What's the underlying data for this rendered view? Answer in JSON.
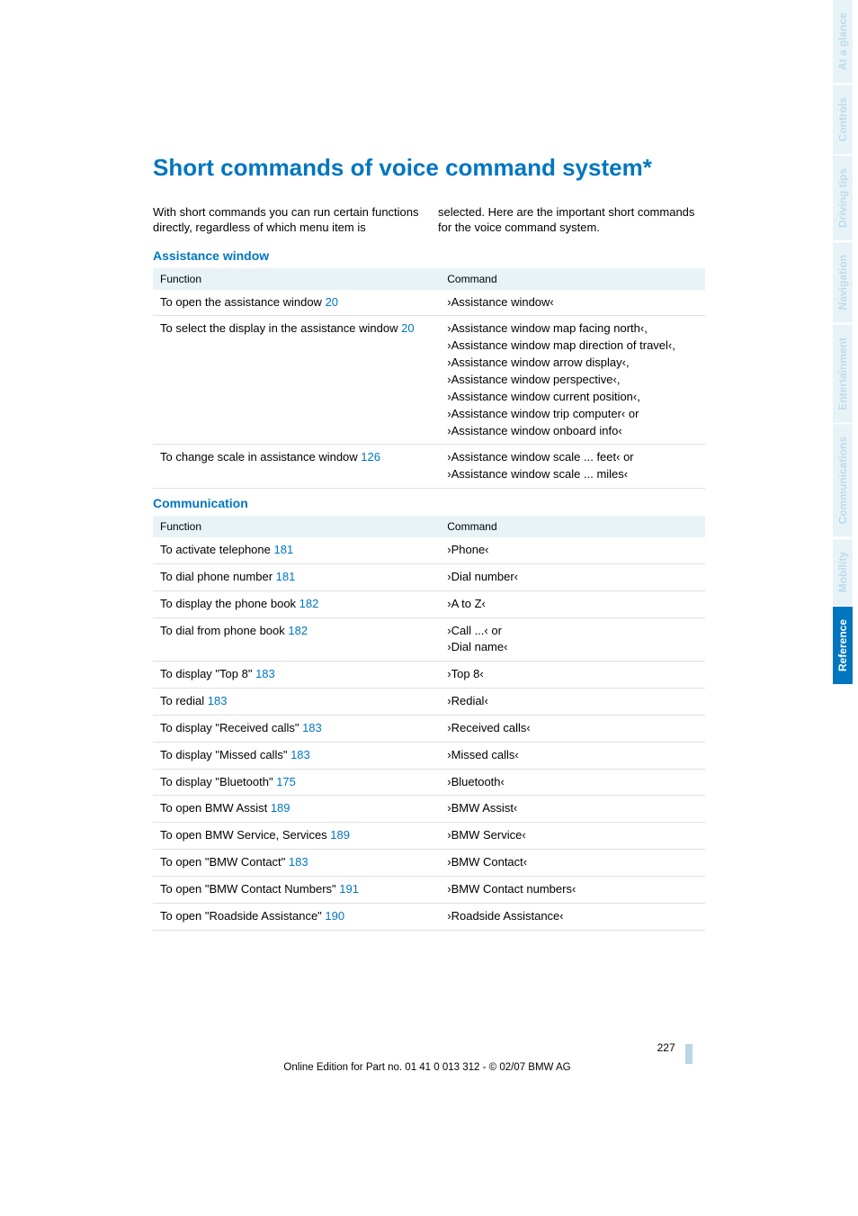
{
  "sideTabs": [
    "At a glance",
    "Controls",
    "Driving tips",
    "Navigation",
    "Entertainment",
    "Communications",
    "Mobility",
    "Reference"
  ],
  "activeTab": "Reference",
  "title": "Short commands of voice command system*",
  "introLeft": "With short commands you can run certain functions directly, regardless of which menu item is",
  "introRight": "selected. Here are the important short commands for the voice command system.",
  "sections": [
    {
      "heading": "Assistance window",
      "headerFn": "Function",
      "headerCmd": "Command",
      "rows": [
        {
          "fn": "To open the assistance window",
          "pg": "20",
          "cmd": "›Assistance window‹"
        },
        {
          "fn": "To select the display in the assistance window",
          "pg": "20",
          "cmd": "›Assistance window map facing north‹,\n›Assistance window map direction of travel‹,\n›Assistance window arrow display‹,\n›Assistance window perspective‹,\n›Assistance window current position‹,\n›Assistance window trip computer‹ or\n›Assistance window onboard info‹"
        },
        {
          "fn": "To change scale in assistance window",
          "pg": "126",
          "cmd": "›Assistance window scale ... feet‹ or\n›Assistance window scale ... miles‹"
        }
      ]
    },
    {
      "heading": "Communication",
      "headerFn": "Function",
      "headerCmd": "Command",
      "rows": [
        {
          "fn": "To activate telephone",
          "pg": "181",
          "cmd": "›Phone‹"
        },
        {
          "fn": "To dial phone number",
          "pg": "181",
          "cmd": "›Dial number‹"
        },
        {
          "fn": "To display the phone book",
          "pg": "182",
          "cmd": "›A to Z‹"
        },
        {
          "fn": "To dial from phone book",
          "pg": "182",
          "cmd": "›Call ...‹ or\n›Dial name‹"
        },
        {
          "fn": "To display \"Top 8\"",
          "pg": "183",
          "cmd": "›Top 8‹"
        },
        {
          "fn": "To redial",
          "pg": "183",
          "cmd": "›Redial‹"
        },
        {
          "fn": "To display \"Received calls\"",
          "pg": "183",
          "cmd": "›Received calls‹"
        },
        {
          "fn": "To display \"Missed calls\"",
          "pg": "183",
          "cmd": "›Missed calls‹"
        },
        {
          "fn": "To display \"Bluetooth\"",
          "pg": "175",
          "cmd": "›Bluetooth‹"
        },
        {
          "fn": "To open BMW Assist",
          "pg": "189",
          "cmd": "›BMW Assist‹"
        },
        {
          "fn": "To open BMW Service, Services",
          "pg": "189",
          "cmd": "›BMW Service‹"
        },
        {
          "fn": "To open \"BMW Contact\"",
          "pg": "183",
          "cmd": "›BMW Contact‹"
        },
        {
          "fn": "To open \"BMW Contact Numbers\"",
          "pg": "191",
          "cmd": "›BMW Contact numbers‹"
        },
        {
          "fn": "To open \"Roadside Assistance\"",
          "pg": "190",
          "cmd": "›Roadside Assistance‹"
        }
      ]
    }
  ],
  "pageNumber": "227",
  "footerLine": "Online Edition for Part no. 01 41 0 013 312 - © 02/07 BMW AG"
}
